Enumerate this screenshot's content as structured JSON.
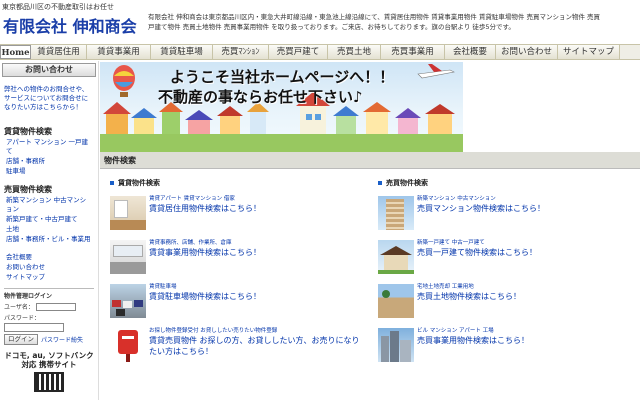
{
  "header": {
    "tagline": "東京都品川区の不動産取引はお任せ",
    "company": "有限会社 伸和商会",
    "intro": "有限会社 伸和商会は東京都品川区内・東急大井町線沿線・東急池上線沿線にて、賃貸居住用物件 賃貸事業用物件 賃貸駐車場物件 売買マンション物件 売買戸建て物件 売買土地物件 売買事業用物件 を取り扱っております。ご来店、お待ちしております。旗の台駅より 徒歩5分です。"
  },
  "nav": [
    "Home",
    "賃貸居住用",
    "賃貸事業用",
    "賃貸駐車場",
    "売買ﾏﾝｼｮﾝ",
    "売買戸建て",
    "売買土地",
    "売買事業用",
    "会社概要",
    "お問い合わせ",
    "サイトマップ"
  ],
  "sidebar": {
    "contact_button": "お問い合わせ",
    "contact_note": "弊社への物件のお問合せや、サービスについてお問合せになりたい方はこちらから！",
    "rental_heading": "賃貸物件検索",
    "rental_links": [
      "アパート マンション 一戸建て",
      "店舗・事務所",
      "駐車場"
    ],
    "sale_heading": "売買物件検索",
    "sale_links": [
      "新築マンション 中古マンション",
      "新築戸建て・中古戸建て",
      "土地",
      "店舗・事務所・ビル・事業用"
    ],
    "misc_links": [
      "会社概要",
      "お問い合わせ",
      "サイトマップ"
    ],
    "login": {
      "title": "物件管理ログイン",
      "user_label": "ユーザ名：",
      "pass_label": "パスワード：",
      "login_button": "ログイン",
      "forgot": "パスワード紛失"
    },
    "mobile_text": "ドコモ, au, ソフトバンク対応 携帯サイト"
  },
  "banner": {
    "line1": "ようこそ当社ホームページへ！！",
    "line2": "不動産の事ならお任せ下さい♪"
  },
  "page_title": "物件検索",
  "rental_column": {
    "heading": "賃貸物件検索",
    "items": [
      {
        "sub": "賃貸アパート 賃貸マンション 借家",
        "main": "賃貸居住用物件検索はこちら！"
      },
      {
        "sub": "賃貸事務所、店舗、作業所、倉庫",
        "main": "賃貸事業用物件検索はこちら！"
      },
      {
        "sub": "賃貸駐車場",
        "main": "賃貸駐車場物件検索はこちら！"
      },
      {
        "sub": "お探し物件登録受付 お貸ししたい売りたい物件登録",
        "main": "賃貸売買物件 お探しの方、お貸ししたい方、お売りになりたい方はこちら！"
      }
    ]
  },
  "sale_column": {
    "heading": "売買物件検索",
    "items": [
      {
        "sub": "新築マンション 中古マンション",
        "main": "売買マンション物件検索はこちら！"
      },
      {
        "sub": "新築一戸建て 中古一戸建て",
        "main": "売買一戸建て物件検索はこちら！"
      },
      {
        "sub": "宅地土地売却 工業用地",
        "main": "売買土地物件検索はこちら！"
      },
      {
        "sub": "ビル マンション アパート 工場",
        "main": "売買事業用物件検索はこちら！"
      }
    ]
  },
  "colors": {
    "link": "#0033aa",
    "logo": "#1a3ea8",
    "bullet": "#1a5fc8"
  }
}
